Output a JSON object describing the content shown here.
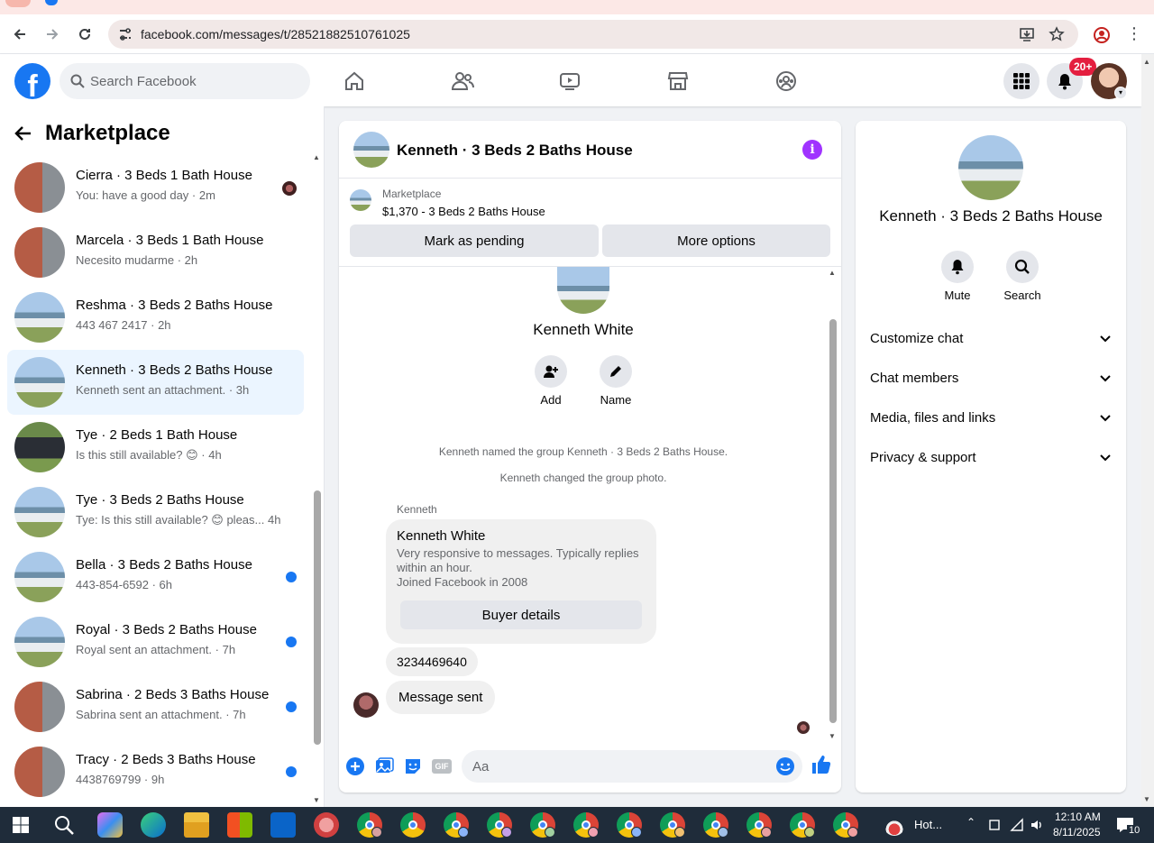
{
  "browser": {
    "url": "facebook.com/messages/t/28521882510761025"
  },
  "fb": {
    "search_placeholder": "Search Facebook",
    "notif_count": "20+"
  },
  "left": {
    "title": "Marketplace",
    "conversations": [
      {
        "name": "Cierra · 3 Beds 1 Bath House",
        "preview": "You: have a good day · 2m",
        "thumb": "brick",
        "mark": "avatar"
      },
      {
        "name": "Marcela · 3 Beds 1 Bath House",
        "preview": "Necesito mudarme · 2h",
        "thumb": "brick",
        "mark": ""
      },
      {
        "name": "Reshma · 3 Beds 2 Baths House",
        "preview": "443 467 2417 · 2h",
        "thumb": "house",
        "mark": ""
      },
      {
        "name": "Kenneth · 3 Beds 2 Baths House",
        "preview": "Kenneth sent an attachment. · 3h",
        "thumb": "house",
        "mark": "",
        "active": true
      },
      {
        "name": "Tye · 2 Beds 1 Bath House",
        "preview": "Is this still available? 😊 · 4h",
        "thumb": "dark",
        "mark": ""
      },
      {
        "name": "Tye · 3 Beds 2 Baths House",
        "preview": "Tye: Is this still available? 😊 pleas...  4h",
        "thumb": "house",
        "mark": ""
      },
      {
        "name": "Bella · 3 Beds 2 Baths House",
        "preview": "443-854-6592 · 6h",
        "thumb": "house",
        "mark": "dot"
      },
      {
        "name": "Royal · 3 Beds 2 Baths House",
        "preview": "Royal sent an attachment. · 7h",
        "thumb": "house",
        "mark": "dot"
      },
      {
        "name": "Sabrina · 2 Beds 3 Baths House",
        "preview": "Sabrina sent an attachment. · 7h",
        "thumb": "brick",
        "mark": "dot"
      },
      {
        "name": "Tracy · 2 Beds 3 Baths House",
        "preview": "4438769799 · 9h",
        "thumb": "brick",
        "mark": "dot"
      }
    ]
  },
  "chat": {
    "title": "Kenneth · 3 Beds 2 Baths House",
    "marketplace_label": "Marketplace",
    "listing": "$1,370 - 3 Beds 2 Baths House",
    "mark_pending": "Mark as pending",
    "more_options": "More options",
    "intro_name": "Kenneth White",
    "add_label": "Add",
    "name_label": "Name",
    "sys1": "Kenneth named the group Kenneth · 3 Beds 2 Baths House.",
    "sys2": "Kenneth changed the group photo.",
    "sender": "Kenneth",
    "card_name": "Kenneth White",
    "card_desc1": "Very responsive to messages. Typically replies within an hour.",
    "card_desc2": "Joined Facebook in 2008",
    "buyer_details": "Buyer details",
    "msg1": "3234469640",
    "msg2": "Message sent",
    "composer_placeholder": "Aa"
  },
  "right": {
    "title": "Kenneth · 3 Beds 2 Baths House",
    "mute": "Mute",
    "search": "Search",
    "sections": [
      "Customize chat",
      "Chat members",
      "Media, files and links",
      "Privacy & support"
    ]
  },
  "taskbar": {
    "weather": "Hot...",
    "time": "12:10 AM",
    "date": "8/11/2025",
    "notif": "10"
  },
  "colors": {
    "fb_blue": "#1877f2",
    "active_bg": "#ebf5ff",
    "info_purple": "#a033ff"
  }
}
